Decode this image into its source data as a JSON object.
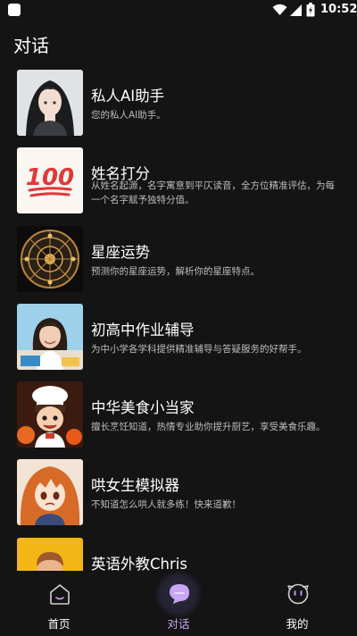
{
  "status_bar": {
    "time": "10:52",
    "icons": [
      "app-icon",
      "wifi-icon",
      "signal-icon",
      "battery-icon"
    ]
  },
  "page": {
    "title": "对话"
  },
  "items": [
    {
      "title": "私人AI助手",
      "desc": "您的私人AI助手。",
      "thumb": "anime-girl-portrait"
    },
    {
      "title": "姓名打分",
      "desc": "从姓名起源，名字寓意到平仄读音，全方位精准评估，为每一个名字赋予独特分值。",
      "thumb": "hundred-points-emoji"
    },
    {
      "title": "星座运势",
      "desc": "预测你的星座运势，解析你的星座特点。",
      "thumb": "zodiac-wheel"
    },
    {
      "title": "初高中作业辅导",
      "desc": "为中小学各学科提供精准辅导与答疑服务的好帮手。",
      "thumb": "student-girl"
    },
    {
      "title": "中华美食小当家",
      "desc": "擅长烹饪知道，热情专业助你提升厨艺，享受美食乐趣。",
      "thumb": "chef-boy"
    },
    {
      "title": "哄女生模拟器",
      "desc": "不知道怎么哄人就多练！快来道歉！",
      "thumb": "anime-girl-orange-hair"
    },
    {
      "title": "英语外教Chris",
      "desc": "",
      "thumb": "smiling-man"
    }
  ],
  "nav": {
    "home": "首页",
    "chat": "对话",
    "me": "我的",
    "active": "chat",
    "accent": "#c9a5f5"
  }
}
